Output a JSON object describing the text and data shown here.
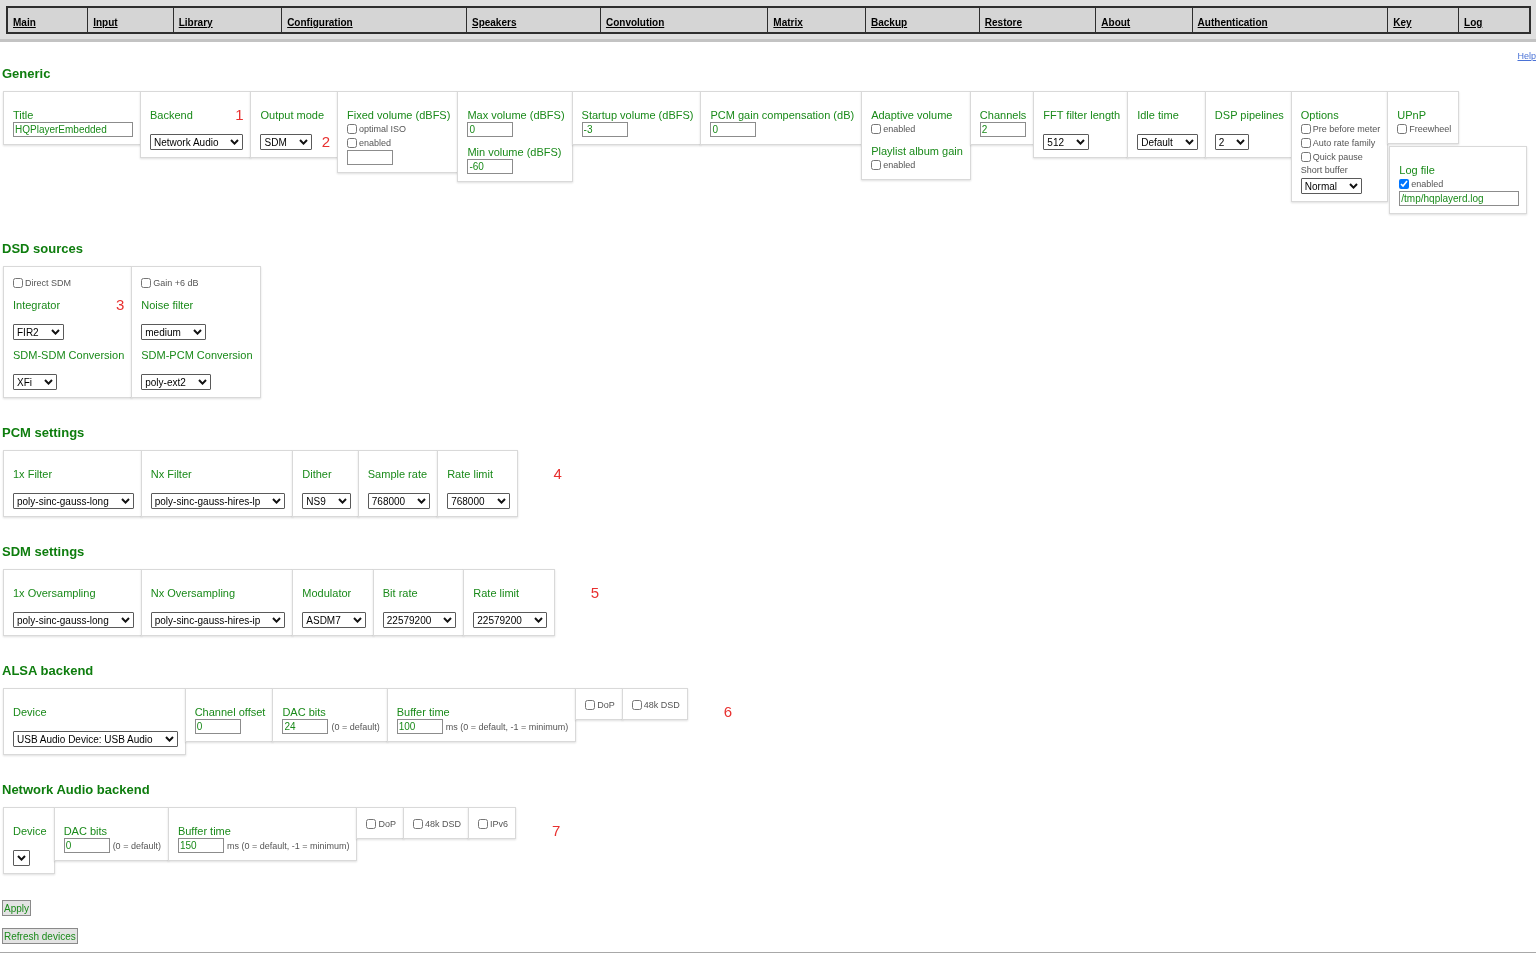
{
  "nav": {
    "tabs": [
      "Main",
      "Input",
      "Library",
      "Configuration",
      "Speakers",
      "Convolution",
      "Matrix",
      "Backup",
      "Restore",
      "About",
      "Authentication",
      "Key",
      "Log"
    ]
  },
  "help_link": "Help",
  "sections": [
    {
      "title": "Generic",
      "groups": [
        {
          "kind": "panel",
          "items": [
            {
              "kind": "heading",
              "text": "Title"
            },
            {
              "kind": "text_input",
              "value": "HQPlayerEmbedded"
            }
          ]
        },
        {
          "kind": "panel",
          "items": [
            {
              "kind": "heading",
              "text": "Backend",
              "annotation": "1"
            },
            {
              "kind": "select",
              "value": "Network Audio"
            }
          ]
        },
        {
          "kind": "panel",
          "items": [
            {
              "kind": "heading",
              "text": "Output mode"
            },
            {
              "kind": "select",
              "value": "SDM",
              "annotation": "2"
            }
          ]
        },
        {
          "kind": "panel",
          "items": [
            {
              "kind": "heading",
              "text": "Fixed volume (dBFS)"
            },
            {
              "kind": "checkbox",
              "label": "optimal ISO",
              "checked": false
            },
            {
              "kind": "checkbox",
              "label": "enabled",
              "checked": false
            },
            {
              "kind": "number_input"
            }
          ]
        },
        {
          "kind": "panel",
          "items": [
            {
              "kind": "heading",
              "text": "Max volume (dBFS)"
            },
            {
              "kind": "number_input",
              "value": "0"
            },
            {
              "kind": "heading",
              "text": "Min volume (dBFS)"
            },
            {
              "kind": "number_input",
              "value": "-60"
            }
          ]
        },
        {
          "kind": "panel",
          "items": [
            {
              "kind": "heading",
              "text": "Startup volume (dBFS)"
            },
            {
              "kind": "number_input",
              "value": "-3"
            }
          ]
        },
        {
          "kind": "panel",
          "items": [
            {
              "kind": "heading",
              "text": "PCM gain compensation (dB)"
            },
            {
              "kind": "number_input",
              "value": "0"
            }
          ]
        },
        {
          "kind": "panel",
          "items": [
            {
              "kind": "heading",
              "text": "Adaptive volume"
            },
            {
              "kind": "checkbox",
              "label": "enabled",
              "checked": false
            },
            {
              "kind": "heading",
              "text": "Playlist album gain"
            },
            {
              "kind": "checkbox",
              "label": "enabled",
              "checked": false
            }
          ]
        },
        {
          "kind": "panel",
          "items": [
            {
              "kind": "heading",
              "text": "Channels"
            },
            {
              "kind": "number_input",
              "value": "2"
            }
          ]
        },
        {
          "kind": "panel",
          "items": [
            {
              "kind": "heading",
              "text": "FFT filter length"
            },
            {
              "kind": "select",
              "value": "512"
            }
          ]
        },
        {
          "kind": "panel",
          "items": [
            {
              "kind": "heading",
              "text": "Idle time"
            },
            {
              "kind": "select",
              "value": "Default"
            }
          ]
        },
        {
          "kind": "panel",
          "items": [
            {
              "kind": "heading",
              "text": "DSP pipelines"
            },
            {
              "kind": "select",
              "value": "2"
            }
          ]
        },
        {
          "kind": "panel",
          "items": [
            {
              "kind": "heading",
              "text": "Options"
            },
            {
              "kind": "checkbox",
              "label": "Pre before meter",
              "checked": false
            },
            {
              "kind": "checkbox",
              "label": "Auto rate family",
              "checked": false
            },
            {
              "kind": "checkbox",
              "label": "Quick pause",
              "checked": false
            },
            {
              "kind": "caption",
              "text": "Short buffer"
            },
            {
              "kind": "select",
              "value": "Normal"
            }
          ]
        },
        {
          "kind": "stack",
          "panels": [
            {
              "items": [
                {
                  "kind": "heading",
                  "text": "UPnP"
                },
                {
                  "kind": "checkbox",
                  "label": "Freewheel",
                  "checked": false
                }
              ]
            },
            {
              "items": [
                {
                  "kind": "heading",
                  "text": "Log file"
                },
                {
                  "kind": "checkbox",
                  "label": "enabled",
                  "checked": true
                },
                {
                  "kind": "text_input",
                  "value": "/tmp/hqplayerd.log"
                }
              ]
            }
          ]
        }
      ]
    },
    {
      "title": "DSD sources",
      "groups": [
        {
          "kind": "panel",
          "items": [
            {
              "kind": "checkbox",
              "label": "Direct SDM",
              "checked": false
            },
            {
              "kind": "heading",
              "text": "Integrator",
              "annotation": "3"
            },
            {
              "kind": "select",
              "value": "FIR2"
            },
            {
              "kind": "heading",
              "text": "SDM-SDM Conversion"
            },
            {
              "kind": "select",
              "value": "XFi"
            }
          ]
        },
        {
          "kind": "panel",
          "items": [
            {
              "kind": "checkbox",
              "label": "Gain +6 dB",
              "checked": false
            },
            {
              "kind": "heading",
              "text": "Noise filter"
            },
            {
              "kind": "select",
              "value": "medium"
            },
            {
              "kind": "heading",
              "text": "SDM-PCM Conversion"
            },
            {
              "kind": "select",
              "value": "poly-ext2"
            }
          ]
        }
      ]
    },
    {
      "title": "PCM settings",
      "annotation": "4",
      "groups": [
        {
          "kind": "panel",
          "items": [
            {
              "kind": "heading",
              "text": "1x Filter"
            },
            {
              "kind": "select",
              "value": "poly-sinc-gauss-long"
            }
          ]
        },
        {
          "kind": "panel",
          "items": [
            {
              "kind": "heading",
              "text": "Nx Filter"
            },
            {
              "kind": "select",
              "value": "poly-sinc-gauss-hires-lp"
            }
          ]
        },
        {
          "kind": "panel",
          "items": [
            {
              "kind": "heading",
              "text": "Dither"
            },
            {
              "kind": "select",
              "value": "NS9"
            }
          ]
        },
        {
          "kind": "panel",
          "items": [
            {
              "kind": "heading",
              "text": "Sample rate"
            },
            {
              "kind": "select",
              "value": "768000"
            }
          ]
        },
        {
          "kind": "panel",
          "items": [
            {
              "kind": "heading",
              "text": "Rate limit"
            },
            {
              "kind": "select",
              "value": "768000"
            }
          ]
        }
      ]
    },
    {
      "title": "SDM settings",
      "annotation": "5",
      "groups": [
        {
          "kind": "panel",
          "items": [
            {
              "kind": "heading",
              "text": "1x Oversampling"
            },
            {
              "kind": "select",
              "value": "poly-sinc-gauss-long"
            }
          ]
        },
        {
          "kind": "panel",
          "items": [
            {
              "kind": "heading",
              "text": "Nx Oversampling"
            },
            {
              "kind": "select",
              "value": "poly-sinc-gauss-hires-ip"
            }
          ]
        },
        {
          "kind": "panel",
          "items": [
            {
              "kind": "heading",
              "text": "Modulator"
            },
            {
              "kind": "select",
              "value": "ASDM7"
            }
          ]
        },
        {
          "kind": "panel",
          "items": [
            {
              "kind": "heading",
              "text": "Bit rate"
            },
            {
              "kind": "select",
              "value": "22579200"
            }
          ]
        },
        {
          "kind": "panel",
          "items": [
            {
              "kind": "heading",
              "text": "Rate limit"
            },
            {
              "kind": "select",
              "value": "22579200"
            }
          ]
        }
      ]
    },
    {
      "title": "ALSA backend",
      "annotation": "6",
      "groups": [
        {
          "kind": "panel",
          "items": [
            {
              "kind": "heading",
              "text": "Device"
            },
            {
              "kind": "select",
              "value": "USB Audio Device: USB Audio"
            }
          ]
        },
        {
          "kind": "panel",
          "items": [
            {
              "kind": "heading",
              "text": "Channel offset"
            },
            {
              "kind": "number_input",
              "value": "0"
            }
          ]
        },
        {
          "kind": "panel",
          "items": [
            {
              "kind": "heading",
              "text": "DAC bits"
            },
            {
              "kind": "number_input",
              "value": "24",
              "suffix": "(0 = default)"
            }
          ]
        },
        {
          "kind": "panel",
          "items": [
            {
              "kind": "heading",
              "text": "Buffer time"
            },
            {
              "kind": "number_input",
              "value": "100",
              "suffix": "ms (0 = default, -1 = minimum)"
            }
          ]
        },
        {
          "kind": "panel",
          "items": [
            {
              "kind": "checkbox",
              "label": "DoP",
              "checked": false
            }
          ]
        },
        {
          "kind": "panel",
          "items": [
            {
              "kind": "checkbox",
              "label": "48k DSD",
              "checked": false
            }
          ]
        }
      ]
    },
    {
      "title": "Network Audio backend",
      "annotation": "7",
      "groups": [
        {
          "kind": "panel",
          "items": [
            {
              "kind": "heading",
              "text": "Device"
            },
            {
              "kind": "select"
            }
          ]
        },
        {
          "kind": "panel",
          "items": [
            {
              "kind": "heading",
              "text": "DAC bits"
            },
            {
              "kind": "number_input",
              "value": "0",
              "suffix": "(0 = default)"
            }
          ]
        },
        {
          "kind": "panel",
          "items": [
            {
              "kind": "heading",
              "text": "Buffer time"
            },
            {
              "kind": "number_input",
              "value": "150",
              "suffix": "ms (0 = default, -1 = minimum)"
            }
          ]
        },
        {
          "kind": "panel",
          "items": [
            {
              "kind": "checkbox",
              "label": "DoP",
              "checked": false
            }
          ]
        },
        {
          "kind": "panel",
          "items": [
            {
              "kind": "checkbox",
              "label": "48k DSD",
              "checked": false
            }
          ]
        },
        {
          "kind": "panel",
          "items": [
            {
              "kind": "checkbox",
              "label": "IPv6",
              "checked": false
            }
          ]
        }
      ]
    }
  ],
  "actions": [
    "Apply",
    "Refresh devices"
  ]
}
